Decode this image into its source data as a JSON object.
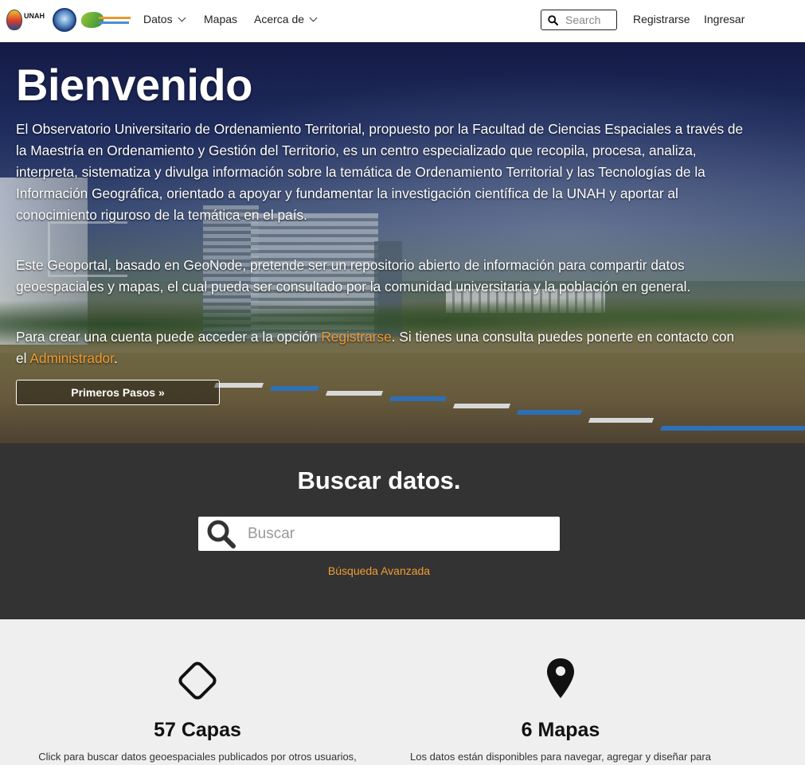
{
  "navbar": {
    "logos": [
      {
        "name": "unah-logo",
        "text": "UNAH"
      },
      {
        "name": "faces-logo"
      },
      {
        "name": "observatorio-logo"
      }
    ],
    "menu": [
      {
        "label": "Datos",
        "dropdown": true
      },
      {
        "label": "Mapas",
        "dropdown": false
      },
      {
        "label": "Acerca de",
        "dropdown": true
      }
    ],
    "search_placeholder": "Search",
    "register": "Registrarse",
    "login": "Ingresar"
  },
  "hero": {
    "title": "Bienvenido",
    "p1": "El Observatorio Universitario de Ordenamiento Territorial, propuesto por la Facultad de Ciencias Espaciales a través de la Maestría en Ordenamiento y Gestión del Territorio, es un centro especializado que recopila, procesa, analiza, interpreta, sistematiza y divulga información sobre la temática de Ordenamiento Territorial y las Tecnologías de la Información Geográfica, orientado a apoyar y fundamentar la investigación científica de la UNAH y aportar al conocimiento riguroso de la temática en el país.",
    "p2": "Este Geoportal, basado en GeoNode, pretende ser un repositorio abierto de información para compartir datos geoespaciales y mapas, el cual pueda ser consultado por la comunidad universitaria y la población en general.",
    "p3_a": "Para crear una cuenta puede acceder a la opción ",
    "p3_link1": "Registrarse",
    "p3_b": ". Si tienes una consulta puedes ponerte en contacto con el ",
    "p3_link2": "Administrador",
    "p3_c": ".",
    "button": "Primeros Pasos »"
  },
  "search": {
    "title": "Buscar datos.",
    "placeholder": "Buscar",
    "advanced": "Búsqueda Avanzada"
  },
  "features": [
    {
      "icon": "diamond-icon",
      "title": "57 Capas",
      "desc": "Click para buscar datos geoespaciales publicados por otros usuarios,"
    },
    {
      "icon": "map-marker-icon",
      "title": "6 Mapas",
      "desc": "Los datos están disponibles para navegar, agregar y diseñar para"
    }
  ],
  "colors": {
    "accent": "#f39c33",
    "search_bg": "#333333",
    "features_bg": "#efefef"
  }
}
